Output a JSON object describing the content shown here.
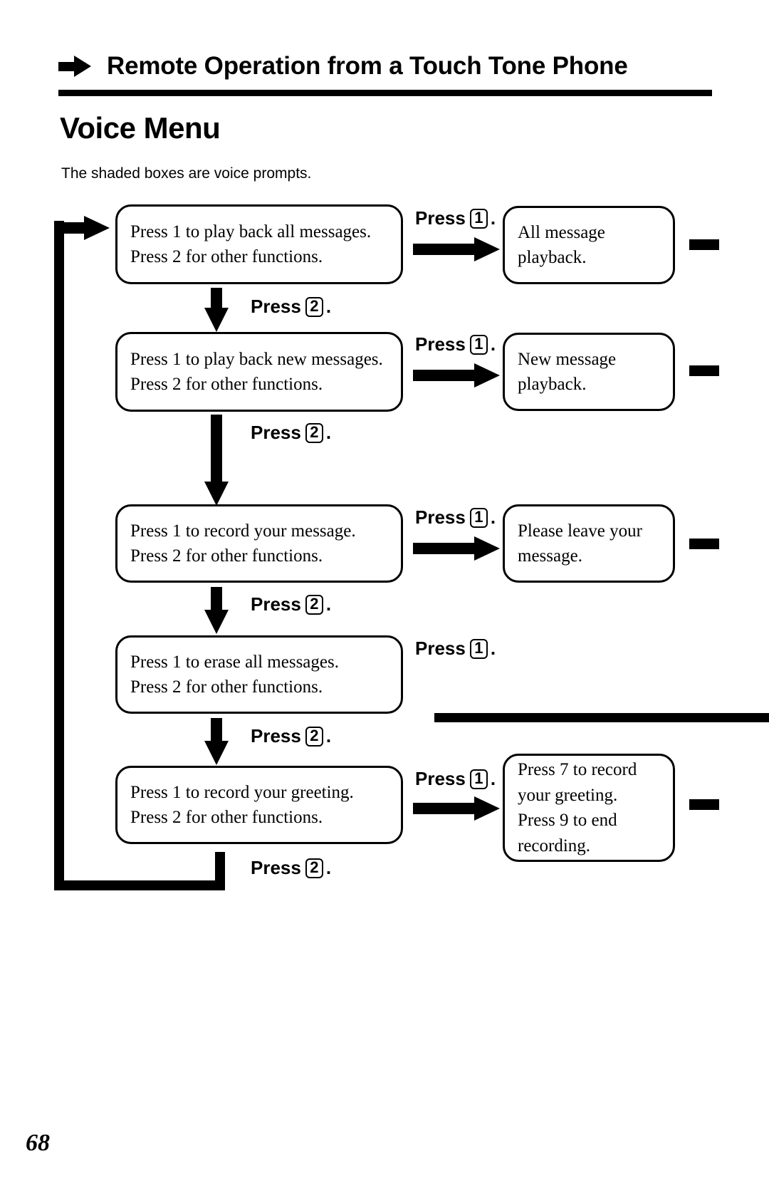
{
  "header": {
    "arrow_icon": "right-arrow-icon",
    "title": "Remote Operation from a Touch Tone Phone"
  },
  "section": {
    "title": "Voice Menu",
    "caption": "The shaded boxes are voice prompts."
  },
  "labels": {
    "press_word": "Press",
    "period": ".",
    "key_1": "1",
    "key_2": "2"
  },
  "flow": {
    "steps": [
      {
        "id": "playback-all",
        "menu_line1": "Press 1 to play back all messages.",
        "menu_line2": "Press 2 for other functions.",
        "press_1_label": "Press",
        "press_1_key": "1",
        "prompt_line1": "All message",
        "prompt_line2": "playback.",
        "press_2_label": "Press",
        "press_2_key": "2"
      },
      {
        "id": "playback-new",
        "menu_line1": "Press 1 to play back new messages.",
        "menu_line2": "Press 2 for other functions.",
        "press_1_label": "Press",
        "press_1_key": "1",
        "prompt_line1": "New message",
        "prompt_line2": "playback.",
        "press_2_label": "Press",
        "press_2_key": "2"
      },
      {
        "id": "record-message",
        "menu_line1": "Press 1 to record your message.",
        "menu_line2": "Press 2 for other functions.",
        "press_1_label": "Press",
        "press_1_key": "1",
        "prompt_line1": "Please leave your",
        "prompt_line2": "message.",
        "press_2_label": "Press",
        "press_2_key": "2"
      },
      {
        "id": "erase-all",
        "menu_line1": "Press 1 to erase all messages.",
        "menu_line2": "Press 2 for other functions.",
        "press_1_label": "Press",
        "press_1_key": "1",
        "press_2_label": "Press",
        "press_2_key": "2"
      },
      {
        "id": "record-greeting",
        "menu_line1": "Press 1 to record your greeting.",
        "menu_line2": "Press 2 for other functions.",
        "press_1_label": "Press",
        "press_1_key": "1",
        "prompt_line1": "Press 7 to record",
        "prompt_line2": "your greeting.",
        "prompt_line3": "Press 9 to end",
        "prompt_line4": "recording.",
        "press_2_label": "Press",
        "press_2_key": "2"
      }
    ]
  },
  "footer": {
    "page_number": "68"
  }
}
